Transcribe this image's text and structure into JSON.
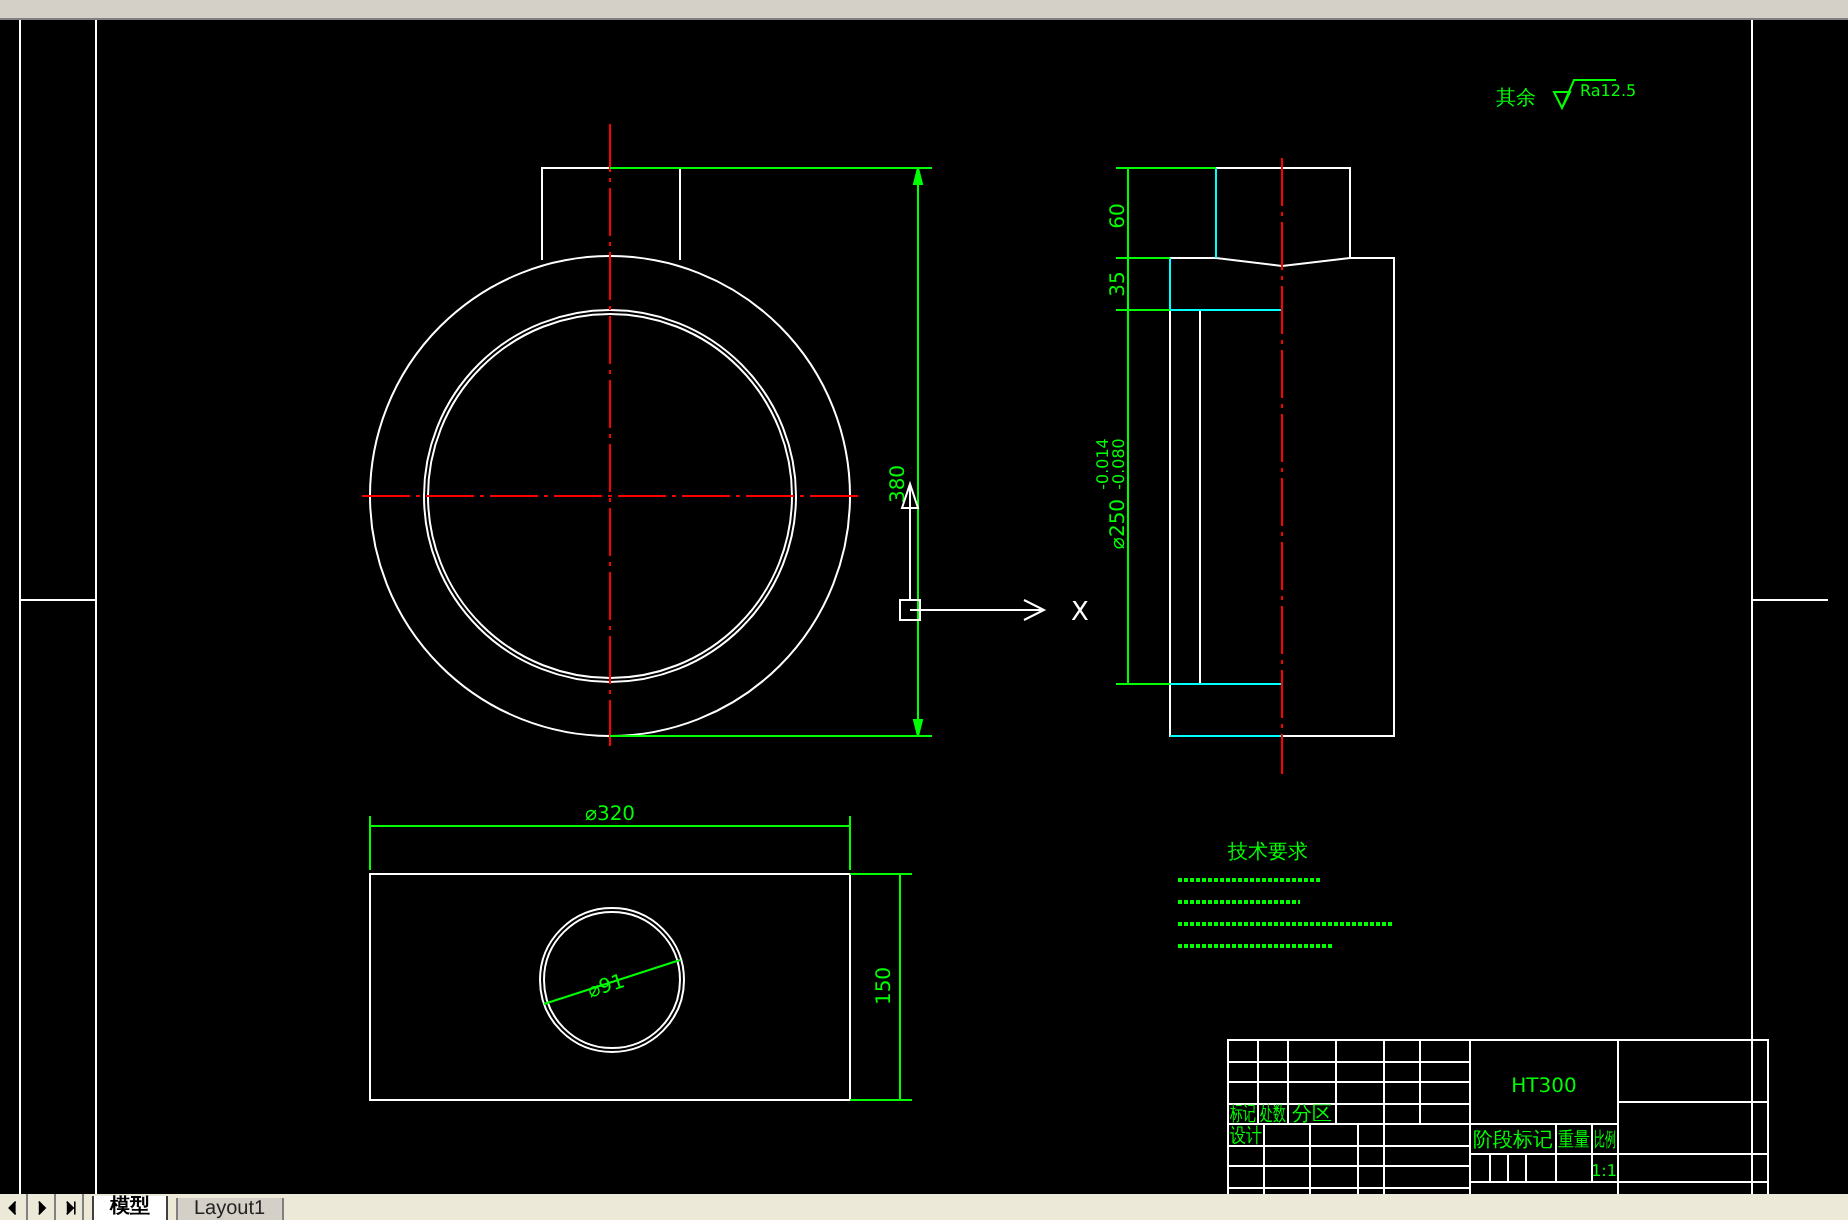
{
  "drawing": {
    "front_view": {
      "height_dim": "380"
    },
    "ucs": {
      "x_label": "X"
    },
    "side_view": {
      "dims": [
        "60",
        "35",
        "⌀250"
      ],
      "tolerances": [
        "-0.014",
        "-0.080"
      ]
    },
    "surface_note": {
      "label": "其余",
      "value": "Ra12.5"
    },
    "top_view": {
      "width_dim": "⌀320",
      "height_dim": "150",
      "hole_dim": "⌀91"
    },
    "notes_title": "技术要求",
    "title_block": {
      "material": "HT300",
      "headers": [
        "标记",
        "处数",
        "分区"
      ],
      "side_labels": [
        "设计"
      ],
      "stage_headers": [
        "阶段标记",
        "重量",
        "比例"
      ],
      "scale": "1:1"
    }
  },
  "layout_tabs": [
    {
      "label": "模型",
      "selected": true
    },
    {
      "label": "Layout1",
      "selected": false
    }
  ]
}
